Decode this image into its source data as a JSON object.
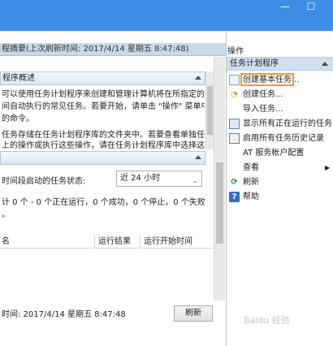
{
  "window": {
    "minimize_glyph": "—",
    "maximize_glyph": "☐"
  },
  "summary_bar": "程摘要(上次刷新时间: 2017/4/14 星期五 8:47:48)",
  "overview": {
    "header": "程序概述",
    "lines": [
      "可以使用任务计划程序来创建和管理计算机将在所指定的时",
      "间自动执行的常见任务。若要开始，请单击 \"操作\" 菜单中",
      "的命令。",
      "",
      "任务存储在任务计划程序库的文件夹中。若要查看单独任务",
      "上的操作或执行这些操作，请在任务计划程序库中选择这"
    ]
  },
  "status": {
    "label": "时间段启动的任务状态:",
    "select_value": "近 24 小时",
    "summary_line1": "计 0 个 - 0 个正在运行，0 个成功，0 个停止，0 个失败",
    "summary_line2": "。",
    "columns": [
      "名",
      "运行结果",
      "运行开始时间"
    ]
  },
  "footer": {
    "refresh_time": "时间: 2017/4/14 星期五 8:47:48",
    "refresh_button": "刷新"
  },
  "actions": {
    "pane_title": "操作",
    "section": "任务计划程序",
    "items": [
      {
        "label": "创建基本任务...",
        "icon": "task-create-icon"
      },
      {
        "label": "创建任务...",
        "icon": "task-icon"
      },
      {
        "label": "导入任务...",
        "icon": ""
      },
      {
        "label": "显示所有正在运行的任务",
        "icon": "running-tasks-icon"
      },
      {
        "label": "启用所有任务历史记录",
        "icon": "history-icon"
      },
      {
        "label": "AT 服务帐户配置",
        "icon": ""
      },
      {
        "label": "查看",
        "icon": ""
      },
      {
        "label": "刷新",
        "icon": "refresh-icon"
      },
      {
        "label": "帮助",
        "icon": "help-icon"
      }
    ]
  },
  "watermark": "Baidu 经验",
  "colors": {
    "titlebar": "#3c8de3",
    "highlight": "#f29a2b",
    "section": "#d0e0f1"
  }
}
